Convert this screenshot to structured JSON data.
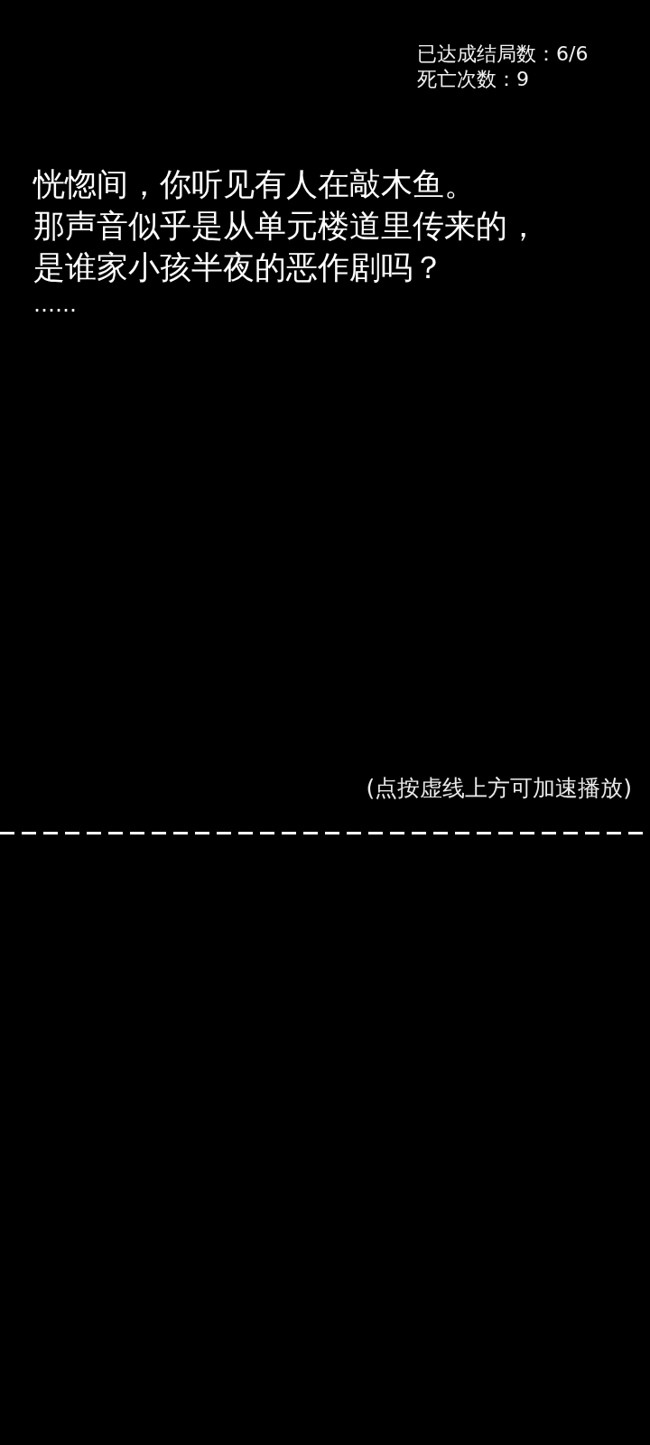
{
  "stats": [
    "已达成结局数：6/6",
    "死亡次数：9"
  ],
  "story": {
    "lines": [
      "恍惚间，你听见有人在敲木鱼。",
      "那声音似乎是从单元楼道里传来的，",
      "是谁家小孩半夜的恶作剧吗？",
      "……"
    ]
  },
  "hint": "(点按虚线上方可加速播放)"
}
